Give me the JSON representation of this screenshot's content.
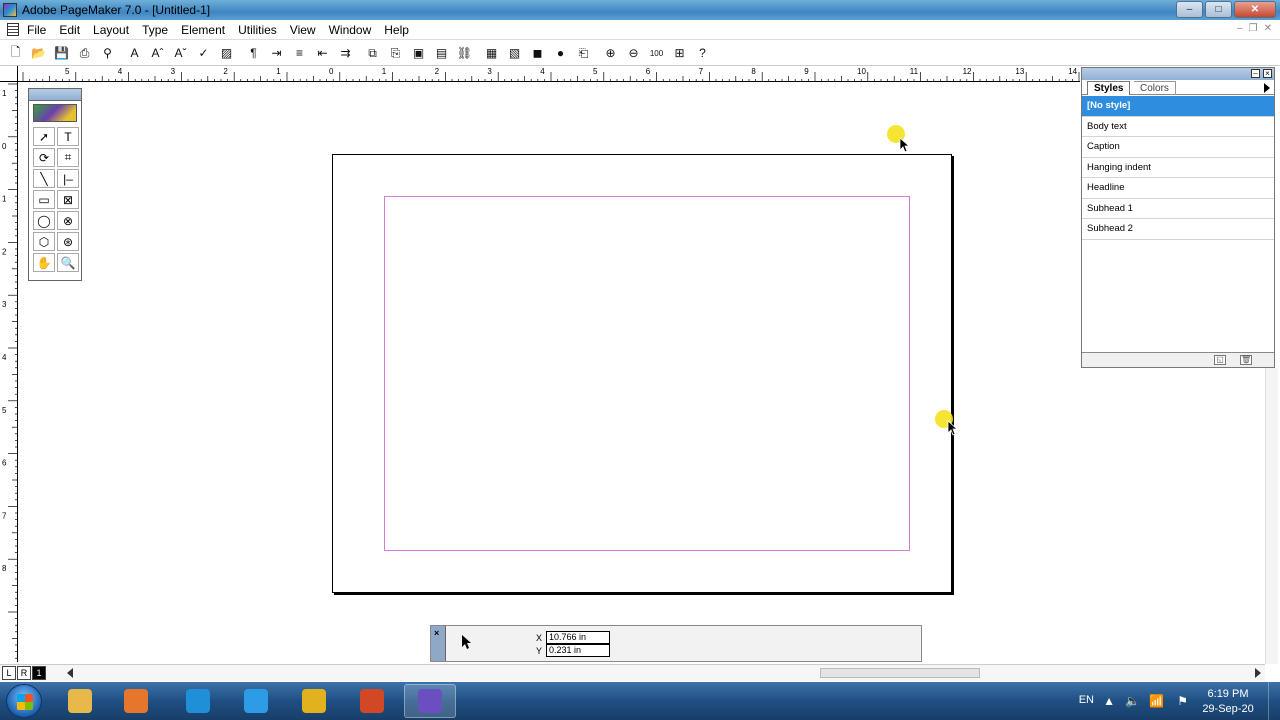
{
  "window": {
    "title": "Adobe PageMaker 7.0 - [Untitled-1]",
    "controls": {
      "minimize": "–",
      "maximize": "□",
      "close": "✕"
    }
  },
  "menubar": {
    "items": [
      "File",
      "Edit",
      "Layout",
      "Type",
      "Element",
      "Utilities",
      "View",
      "Window",
      "Help"
    ],
    "mdi_controls": {
      "minimize": "–",
      "restore": "❐",
      "close": "✕"
    }
  },
  "toolbar": {
    "buttons": [
      {
        "name": "new-document-icon",
        "glyph": "🗋"
      },
      {
        "name": "open-icon",
        "glyph": "📂"
      },
      {
        "name": "save-icon",
        "glyph": "💾"
      },
      {
        "name": "print-icon",
        "glyph": "⎙"
      },
      {
        "name": "find-icon",
        "glyph": "⚲"
      },
      {
        "name": "character-icon",
        "glyph": "A"
      },
      {
        "name": "font-size-icon",
        "glyph": "Aˆ"
      },
      {
        "name": "font-icon",
        "glyph": "Aˇ"
      },
      {
        "name": "spelling-icon",
        "glyph": "✓"
      },
      {
        "name": "fill-stroke-icon",
        "glyph": "▨"
      },
      {
        "name": "paragraph-icon",
        "glyph": "¶"
      },
      {
        "name": "tab-indent-icon",
        "glyph": "⇥"
      },
      {
        "name": "bullets-icon",
        "glyph": "≡"
      },
      {
        "name": "indent-icon",
        "glyph": "⇤"
      },
      {
        "name": "outdent-icon",
        "glyph": "⇉"
      },
      {
        "name": "copy-icon",
        "glyph": "⧉"
      },
      {
        "name": "paste-icon",
        "glyph": "⎘"
      },
      {
        "name": "frame-icon",
        "glyph": "▣"
      },
      {
        "name": "group-icon",
        "glyph": "▤"
      },
      {
        "name": "link-icon",
        "glyph": "⛓"
      },
      {
        "name": "place-image-icon",
        "glyph": "▦"
      },
      {
        "name": "image-control-icon",
        "glyph": "▧"
      },
      {
        "name": "export-icon",
        "glyph": "◼"
      },
      {
        "name": "html-globe-icon",
        "glyph": "●"
      },
      {
        "name": "pdf-icon",
        "glyph": "⎗"
      },
      {
        "name": "zoom-in-icon",
        "glyph": "⊕"
      },
      {
        "name": "zoom-out-icon",
        "glyph": "⊖"
      },
      {
        "name": "actual-size-icon",
        "glyph": "100"
      },
      {
        "name": "fit-window-icon",
        "glyph": "⊞"
      },
      {
        "name": "help-icon",
        "glyph": "?"
      }
    ]
  },
  "rulers": {
    "top_labels": [
      "5",
      "4",
      "3",
      "2",
      "1",
      "0",
      "1",
      "2",
      "3",
      "4",
      "5",
      "6",
      "7",
      "8",
      "9",
      "10",
      "11",
      "12",
      "13",
      "14"
    ],
    "left_labels": [
      "1",
      "0",
      "1",
      "2",
      "3",
      "4",
      "5",
      "6",
      "7",
      "8"
    ]
  },
  "toolbox": {
    "tools": [
      {
        "name": "pointer-tool-icon",
        "glyph": "➚"
      },
      {
        "name": "text-tool-icon",
        "glyph": "T"
      },
      {
        "name": "rotate-tool-icon",
        "glyph": "⟳"
      },
      {
        "name": "crop-tool-icon",
        "glyph": "⌗"
      },
      {
        "name": "line-tool-icon",
        "glyph": "╲"
      },
      {
        "name": "constrained-line-tool-icon",
        "glyph": "|–"
      },
      {
        "name": "rectangle-tool-icon",
        "glyph": "▭"
      },
      {
        "name": "rectangle-frame-tool-icon",
        "glyph": "⊠"
      },
      {
        "name": "ellipse-tool-icon",
        "glyph": "◯"
      },
      {
        "name": "ellipse-frame-tool-icon",
        "glyph": "⊗"
      },
      {
        "name": "polygon-tool-icon",
        "glyph": "⬡"
      },
      {
        "name": "polygon-frame-tool-icon",
        "glyph": "⊛"
      },
      {
        "name": "hand-tool-icon",
        "glyph": "✋"
      },
      {
        "name": "zoom-tool-icon",
        "glyph": "🔍"
      }
    ]
  },
  "styles_palette": {
    "tabs": [
      "Styles",
      "Colors"
    ],
    "styles": [
      "[No style]",
      "Body text",
      "Caption",
      "Hanging indent",
      "Headline",
      "Subhead 1",
      "Subhead 2"
    ],
    "selected_index": 0,
    "footer_buttons": {
      "new_style": "◱",
      "delete_style": "🗑"
    }
  },
  "control_palette": {
    "x_label": "X",
    "x_value": "10.766 in",
    "y_label": "Y",
    "y_value": "0.231 in"
  },
  "pagination": {
    "pages": [
      "L",
      "R",
      "1"
    ],
    "current": "1"
  },
  "taskbar": {
    "apps": [
      {
        "name": "file-explorer-icon",
        "color": "#e8b84a"
      },
      {
        "name": "media-player-icon",
        "color": "#e6762b"
      },
      {
        "name": "edge-icon",
        "color": "#1f8fd8"
      },
      {
        "name": "internet-explorer-icon",
        "color": "#2d9be6"
      },
      {
        "name": "chrome-icon",
        "color": "#e2b21e"
      },
      {
        "name": "powerpoint-icon",
        "color": "#d24726"
      },
      {
        "name": "pagemaker-icon",
        "color": "#6a4fc0"
      }
    ],
    "language": "EN",
    "time": "6:19 PM",
    "date": "29-Sep-20"
  },
  "colors": {
    "selection_blue": "#2f8de0",
    "margin_guide": "#d47fd4",
    "cursor_highlight": "#f4e21c"
  }
}
